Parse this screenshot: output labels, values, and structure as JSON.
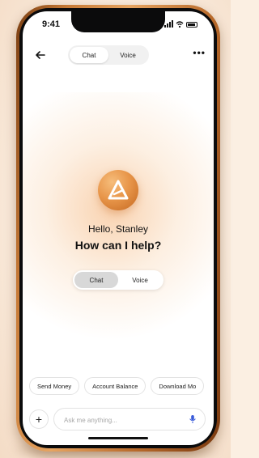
{
  "status_bar": {
    "time": "9:41"
  },
  "header": {
    "tabs": [
      {
        "label": "Chat",
        "active": true
      },
      {
        "label": "Voice",
        "active": false
      }
    ],
    "more_label": "•••"
  },
  "hero": {
    "greeting": "Hello, Stanley",
    "headline": "How can I help?",
    "mode_tabs": [
      {
        "label": "Chat",
        "active": true
      },
      {
        "label": "Voice",
        "active": false
      }
    ]
  },
  "suggestions": [
    "Send Money",
    "Account Balance",
    "Download Mo"
  ],
  "composer": {
    "placeholder": "Ask me anything...",
    "add_label": "+"
  },
  "colors": {
    "accent": "#e8964a",
    "phone_frame": "#c77a36",
    "background": "#fbefe2"
  },
  "icons": {
    "back": "arrow-left-icon",
    "more": "ellipsis-icon",
    "mic": "microphone-icon",
    "logo": "brand-logo-icon"
  }
}
